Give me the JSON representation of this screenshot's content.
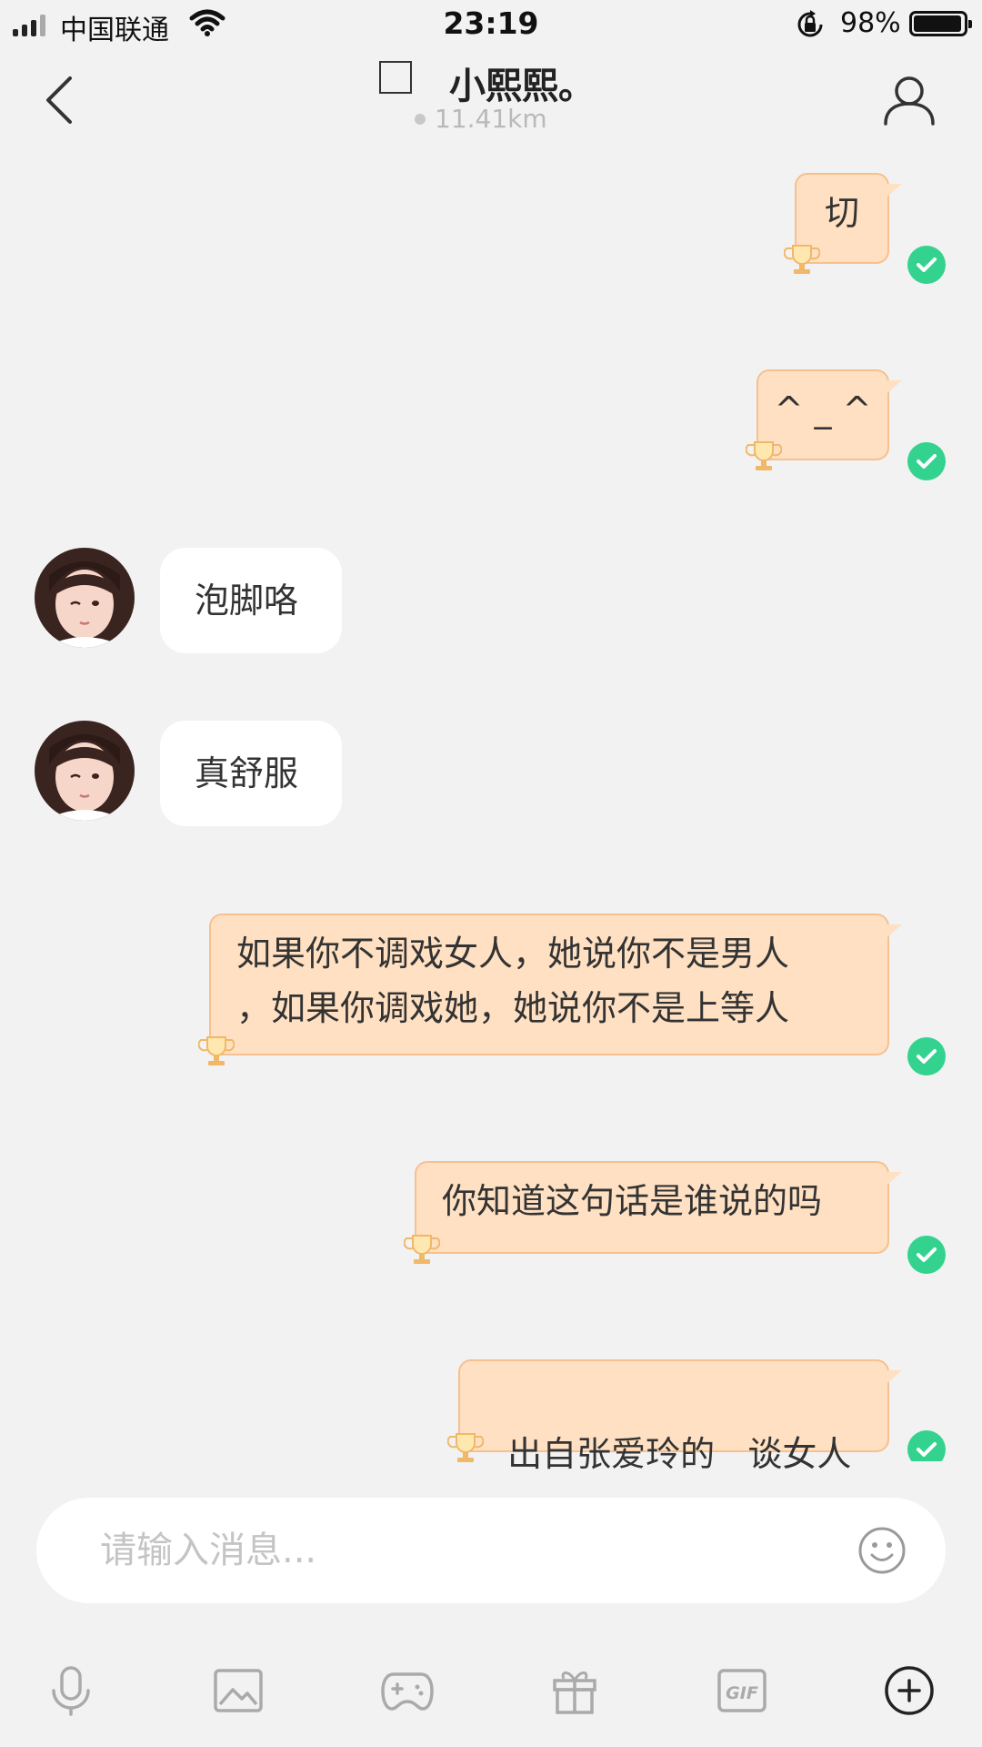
{
  "status_bar": {
    "carrier": "中国联通",
    "time": "23:19",
    "battery_percent": "98%"
  },
  "header": {
    "title": "小熙熙。",
    "distance": "11.41km"
  },
  "messages": [
    {
      "side": "outgoing",
      "text": "切",
      "status": "sent"
    },
    {
      "side": "outgoing",
      "text": "^ _ ^",
      "status": "sent"
    },
    {
      "side": "incoming",
      "text": "泡脚咯"
    },
    {
      "side": "incoming",
      "text": "真舒服"
    },
    {
      "side": "outgoing",
      "lines": [
        "如果你不调戏女人，她说你不是男人",
        "，如果你调戏她，她说你不是上等人"
      ],
      "status": "sent"
    },
    {
      "side": "outgoing",
      "text": "你知道这句话是谁说的吗",
      "status": "sent"
    },
    {
      "side": "outgoing",
      "text": "出自张爱玲的   谈女人",
      "status": "sent"
    }
  ],
  "composer": {
    "placeholder": "请输入消息..."
  },
  "toolbar": {
    "items": [
      "microphone-icon",
      "image-icon",
      "gamepad-icon",
      "gift-icon",
      "gif-icon",
      "plus-circle-icon"
    ],
    "gif_label": "GIF"
  },
  "colors": {
    "outgoing_bubble": "#ffe0c2",
    "outgoing_border": "#f7c08f",
    "sent_check": "#33d38f",
    "background": "#f2f2f2"
  }
}
